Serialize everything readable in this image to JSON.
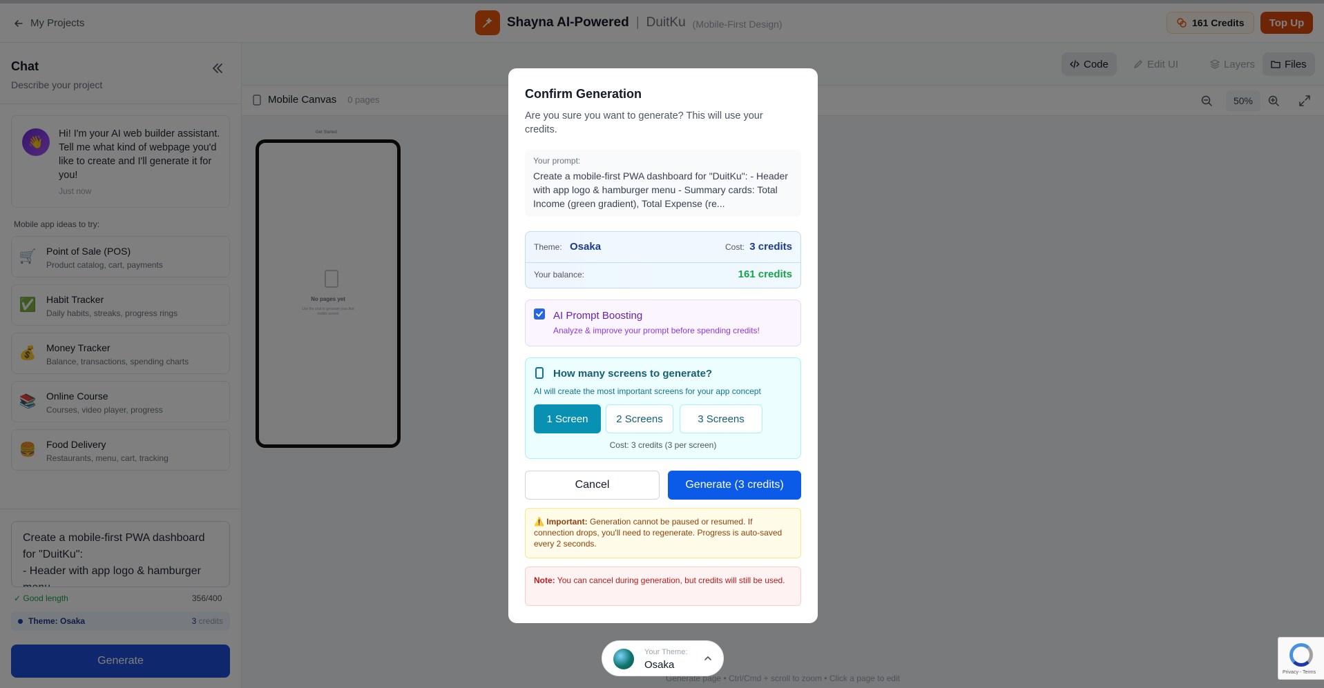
{
  "header": {
    "back_label": "My Projects",
    "brand_title": "Shayna AI-Powered",
    "separator": "|",
    "project_name": "DuitKu",
    "project_subtitle": "(Mobile-First Design)",
    "credits_label": "161 Credits",
    "topup_label": "Top Up"
  },
  "sidebar": {
    "title": "Chat",
    "subtitle": "Describe your project",
    "assistant_message": "Hi! I'm your AI web builder assistant. Tell me what kind of webpage you'd like to create and I'll generate it for you!",
    "assistant_time": "Just now",
    "ideas_label": "Mobile app ideas to try:",
    "ideas": [
      {
        "icon": "cart-icon",
        "emoji": "🛒",
        "title": "Point of Sale (POS)",
        "desc": "Product catalog, cart, payments"
      },
      {
        "icon": "check-icon",
        "emoji": "✅",
        "title": "Habit Tracker",
        "desc": "Daily habits, streaks, progress rings"
      },
      {
        "icon": "money-bag-icon",
        "emoji": "💰",
        "title": "Money Tracker",
        "desc": "Balance, transactions, spending charts"
      },
      {
        "icon": "books-icon",
        "emoji": "📚",
        "title": "Online Course",
        "desc": "Courses, video player, progress"
      },
      {
        "icon": "burger-icon",
        "emoji": "🍔",
        "title": "Food Delivery",
        "desc": "Restaurants, menu, cart, tracking"
      }
    ],
    "prompt_text": "Create a mobile-first PWA dashboard for \"DuitKu\":\n- Header with app logo & hamburger menu",
    "good_length": "✓ Good length",
    "char_count": "356/400",
    "theme_label": "Theme: Osaka",
    "theme_cost_num": "3",
    "theme_cost_unit": "credits",
    "generate_label": "Generate"
  },
  "toolbar": {
    "code": "Code",
    "edit_ui": "Edit UI",
    "layers": "Layers",
    "files": "Files"
  },
  "canvas": {
    "name": "Mobile Canvas",
    "pages": "0 pages",
    "zoom": "50%",
    "phone_label": "Get Started",
    "empty_title": "No pages yet",
    "empty_hint": "Use the chat to generate your first mobile screen",
    "footer": "Generate page • Ctrl/Cmd + scroll to zoom • Click a page to edit"
  },
  "modal": {
    "title": "Confirm Generation",
    "description": "Are you sure you want to generate? This will use your credits.",
    "prompt_label": "Your prompt:",
    "prompt_text": "Create a mobile-first PWA dashboard for \"DuitKu\": - Header with app logo & hamburger menu - Summary cards: Total Income (green gradient), Total Expense (re...",
    "theme_label": "Theme:",
    "theme_value": "Osaka",
    "cost_label": "Cost:",
    "cost_value": "3 credits",
    "balance_label": "Your balance:",
    "balance_value": "161 credits",
    "boost_checked": true,
    "boost_title": "AI Prompt Boosting",
    "boost_desc": "Analyze & improve your prompt before spending credits!",
    "screens_title": "How many screens to generate?",
    "screens_desc": "AI will create the most important screens for your app concept",
    "screen_options": [
      "1 Screen",
      "2 Screens",
      "3 Screens"
    ],
    "screen_selected": "1 Screen",
    "screens_cost": "Cost: 3 credits (3 per screen)",
    "cancel_label": "Cancel",
    "generate_label": "Generate (3 credits)",
    "important_label": "⚠️ Important:",
    "important_text": " Generation cannot be paused or resumed. If connection drops, you'll need to regenerate. Progress is auto-saved every 2 seconds.",
    "note_label": "Note:",
    "note_text": " You can cancel during generation, but credits will still be used."
  },
  "theme_chip": {
    "label": "Your Theme:",
    "name": "Osaka"
  },
  "recaptcha": {
    "text": "Privacy - Terms"
  },
  "colors": {
    "brand_orange": "#ea580c",
    "primary_blue": "#0b5ae8",
    "cyan": "#0891b2",
    "success_green": "#16a34a"
  }
}
